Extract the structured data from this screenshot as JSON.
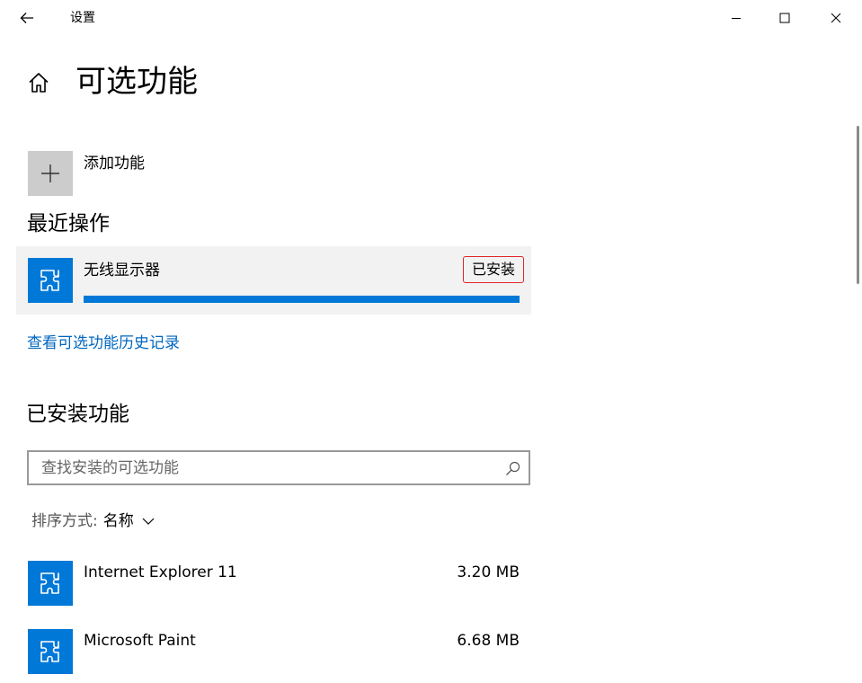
{
  "window": {
    "title": "设置"
  },
  "page": {
    "title": "可选功能"
  },
  "add_feature": {
    "label": "添加功能"
  },
  "recent": {
    "heading": "最近操作",
    "item": {
      "name": "无线显示器",
      "status": "已安装",
      "progress": 1.0
    }
  },
  "history_link": "查看可选功能历史记录",
  "installed": {
    "heading": "已安装功能",
    "search": {
      "placeholder": "查找安装的可选功能",
      "value": ""
    },
    "sort": {
      "label": "排序方式:",
      "value": "名称"
    },
    "items": [
      {
        "name": "Internet Explorer 11",
        "size": "3.20 MB"
      },
      {
        "name": "Microsoft Paint",
        "size": "6.68 MB"
      }
    ]
  },
  "icons": {
    "back": "back-arrow-icon",
    "home": "home-icon",
    "add": "plus-icon",
    "feature": "puzzle-piece-icon",
    "search": "search-icon",
    "chevron": "chevron-down-icon"
  },
  "colors": {
    "accent": "#0078d7",
    "link": "#0067c0",
    "badge_border": "#e0262a",
    "card_bg": "#f2f2f2",
    "add_bg": "#cccccc"
  }
}
